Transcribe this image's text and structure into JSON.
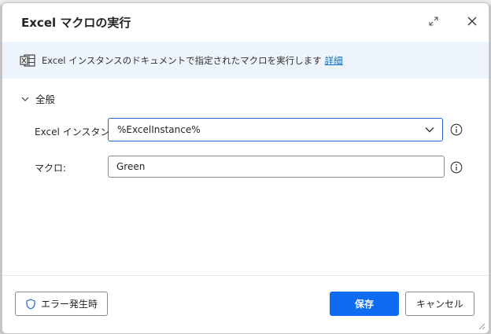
{
  "dialog": {
    "title": "Excel マクロの実行"
  },
  "banner": {
    "text": "Excel インスタンスのドキュメントで指定されたマクロを実行します",
    "link": "詳細"
  },
  "section": {
    "label": "全般"
  },
  "fields": {
    "instance_label": "Excel インスタンス:",
    "instance_value": "%ExcelInstance%",
    "macro_label": "マクロ:",
    "macro_value": "Green"
  },
  "footer": {
    "error_label": "エラー発生時",
    "save_label": "保存",
    "cancel_label": "キャンセル"
  },
  "colors": {
    "accent": "#0f6cf0",
    "link": "#0f6cbd",
    "banner_bg": "#eef4fc"
  },
  "icons": [
    "expand-icon",
    "close-icon",
    "excel-icon",
    "chevron-down-icon",
    "info-icon",
    "shield-icon"
  ]
}
